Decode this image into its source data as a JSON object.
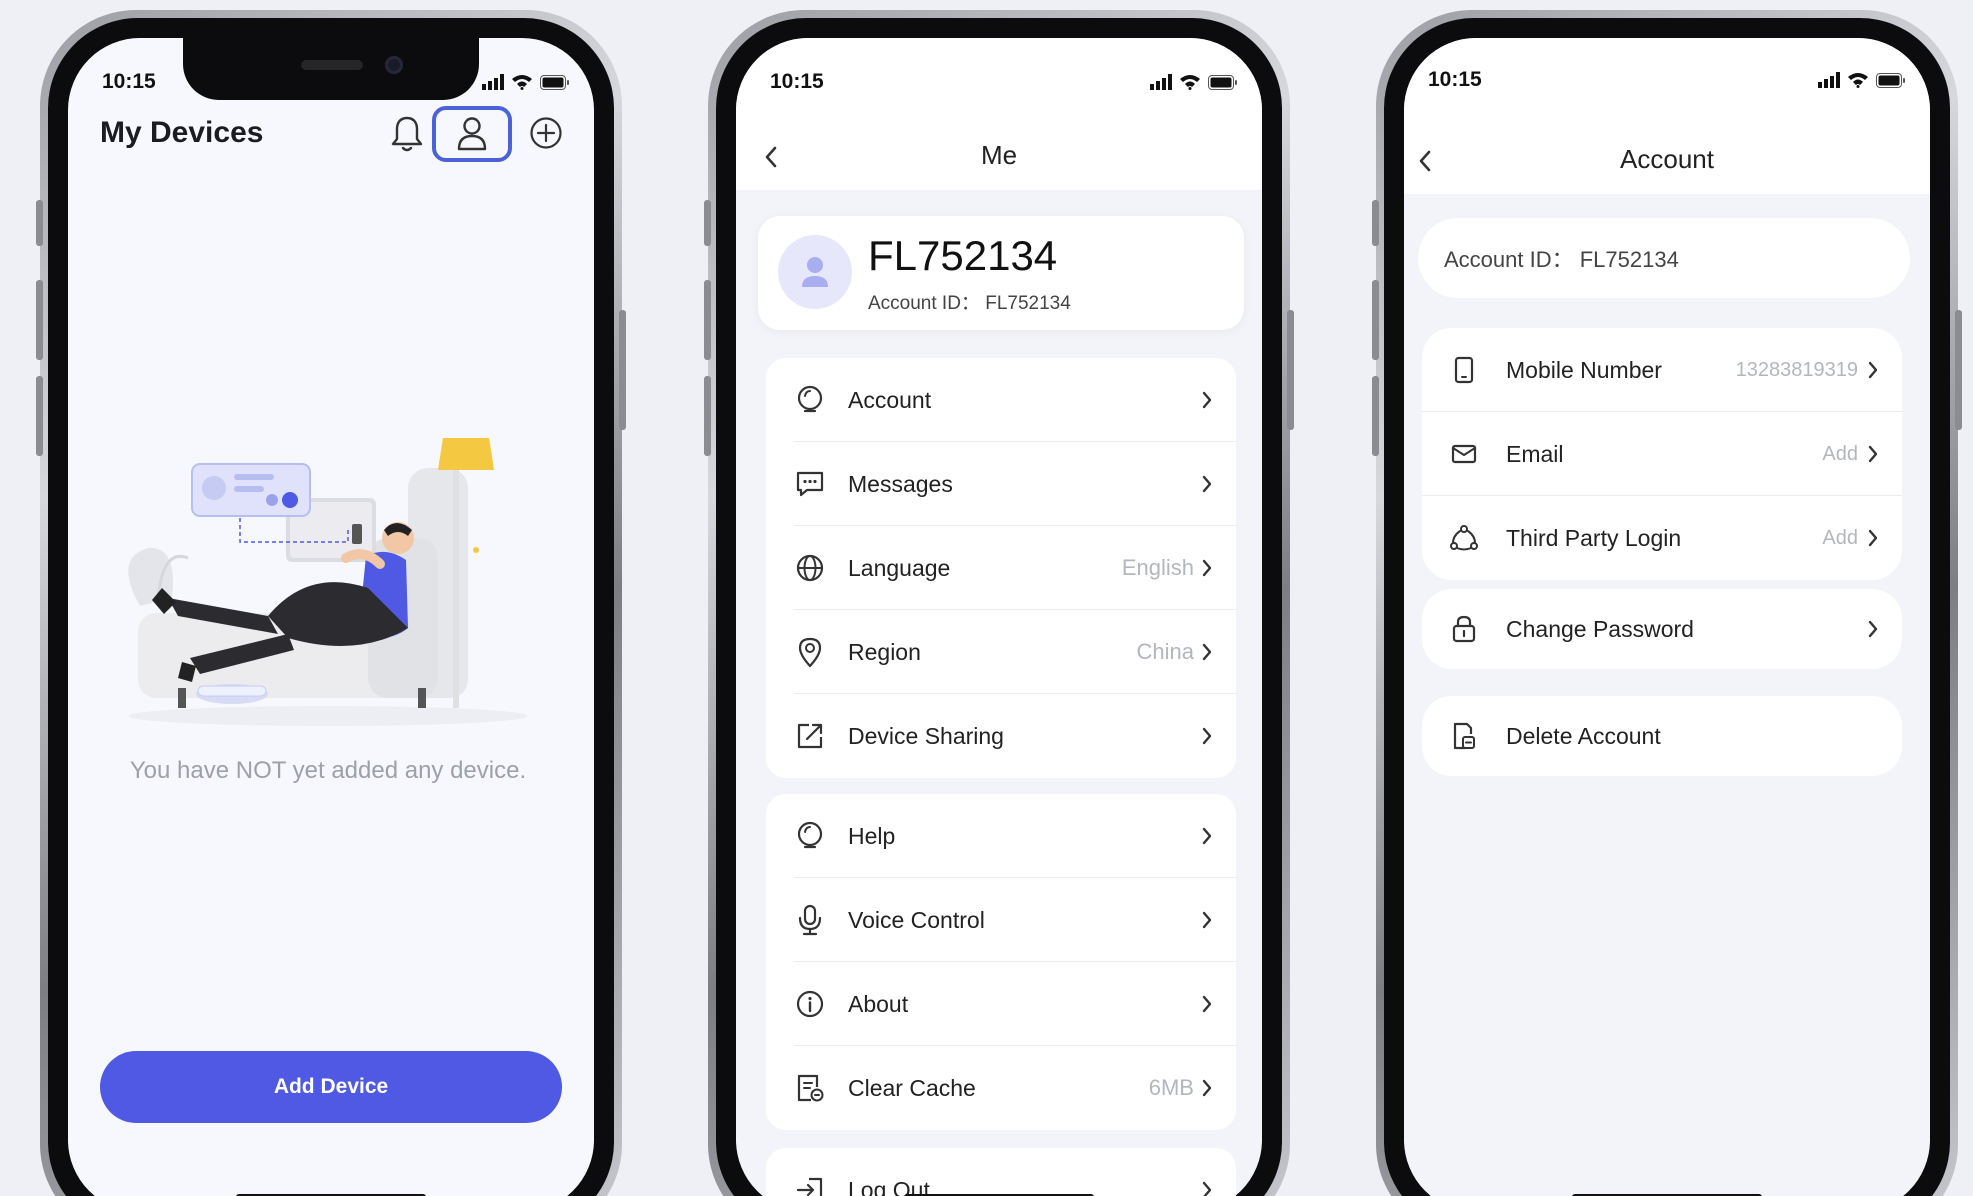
{
  "status": {
    "time": "10:15"
  },
  "screen1": {
    "title": "My Devices",
    "empty_text": "You have NOT yet added any device.",
    "add_button": "Add Device"
  },
  "screen2": {
    "nav_title": "Me",
    "profile": {
      "name": "FL752134",
      "account_id": "Account ID： FL752134"
    },
    "group1": [
      {
        "label": "Account",
        "value": "",
        "icon": "account-icon"
      },
      {
        "label": "Messages",
        "value": "",
        "icon": "messages-icon"
      },
      {
        "label": "Language",
        "value": "English",
        "icon": "globe-icon"
      },
      {
        "label": "Region",
        "value": "China",
        "icon": "location-pin-icon"
      },
      {
        "label": "Device Sharing",
        "value": "",
        "icon": "share-icon"
      }
    ],
    "group2": [
      {
        "label": "Help",
        "value": "",
        "icon": "help-bulb-icon"
      },
      {
        "label": "Voice Control",
        "value": "",
        "icon": "microphone-icon"
      },
      {
        "label": "About",
        "value": "",
        "icon": "info-icon"
      },
      {
        "label": "Clear Cache",
        "value": "6MB",
        "icon": "clear-cache-icon"
      }
    ],
    "logout": "Log Out"
  },
  "screen3": {
    "nav_title": "Account",
    "account_id": "Account ID： FL752134",
    "group1": [
      {
        "label": "Mobile Number",
        "value": "13283819319",
        "icon": "phone-icon"
      },
      {
        "label": "Email",
        "value": "Add",
        "icon": "mail-icon"
      },
      {
        "label": "Third Party Login",
        "value": "Add",
        "icon": "third-party-icon"
      }
    ],
    "change_password": "Change Password",
    "delete_account": "Delete Account"
  },
  "colors": {
    "accent": "#4f59e4",
    "highlight": "#4b63d6"
  }
}
